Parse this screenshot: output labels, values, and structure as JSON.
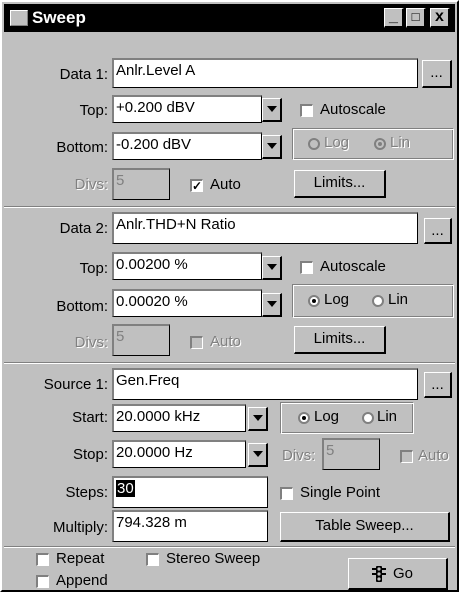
{
  "window": {
    "title": "Sweep",
    "min": "_",
    "max": "□",
    "close": "x"
  },
  "data1": {
    "label": "Data 1:",
    "value": "Anlr.Level A",
    "browse": "...",
    "top_label": "Top:",
    "top_value": "+0.200  dBV",
    "bottom_label": "Bottom:",
    "bottom_value": "-0.200  dBV",
    "autoscale_label": "Autoscale",
    "autoscale_checked": false,
    "log_label": "Log",
    "lin_label": "Lin",
    "scale": "Lin",
    "divs_label": "Divs:",
    "divs_value": "5",
    "auto_label": "Auto",
    "auto_checked": true,
    "limits_label": "Limits..."
  },
  "data2": {
    "label": "Data 2:",
    "value": "Anlr.THD+N Ratio",
    "browse": "...",
    "top_label": "Top:",
    "top_value": "0.00200  %",
    "bottom_label": "Bottom:",
    "bottom_value": "0.00020  %",
    "autoscale_label": "Autoscale",
    "autoscale_checked": false,
    "log_label": "Log",
    "lin_label": "Lin",
    "scale": "Log",
    "divs_label": "Divs:",
    "divs_value": "5",
    "auto_label": "Auto",
    "auto_checked": false,
    "limits_label": "Limits..."
  },
  "source1": {
    "label": "Source 1:",
    "value": "Gen.Freq",
    "browse": "...",
    "start_label": "Start:",
    "start_value": "20.0000 kHz",
    "stop_label": "Stop:",
    "stop_value": "20.0000  Hz",
    "log_label": "Log",
    "lin_label": "Lin",
    "scale": "Log",
    "divs_label": "Divs:",
    "divs_value": "5",
    "auto_label": "Auto",
    "auto_checked": false,
    "steps_label": "Steps:",
    "steps_value": "30",
    "single_point_label": "Single Point",
    "single_point_checked": false,
    "multiply_label": "Multiply:",
    "multiply_value": "794.328 m",
    "table_sweep_label": "Table Sweep..."
  },
  "footer": {
    "repeat_label": "Repeat",
    "stereo_label": "Stereo Sweep",
    "append_label": "Append",
    "go_label": "Go"
  }
}
